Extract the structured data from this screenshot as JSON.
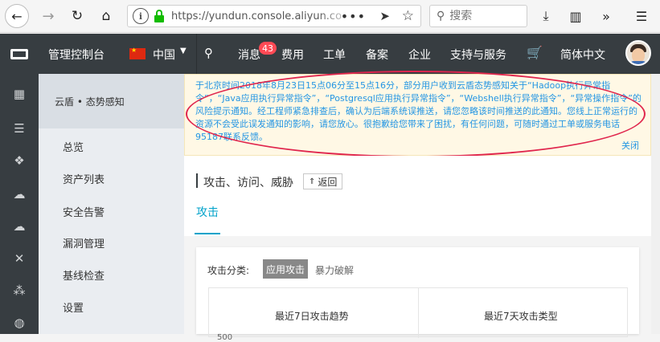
{
  "browser": {
    "url": "https://yundun.console.aliyun.co",
    "search_placeholder": "搜索"
  },
  "topnav": {
    "console_label": "管理控制台",
    "region": "中国",
    "messages_label": "消息",
    "messages_count": "43",
    "items": [
      "费用",
      "工单",
      "备案",
      "企业",
      "支持与服务"
    ],
    "language": "简体中文"
  },
  "sidebar": {
    "product_title": "云盾 • 态势感知",
    "items": [
      "总览",
      "资产列表",
      "安全告警",
      "漏洞管理",
      "基线检查",
      "设置"
    ]
  },
  "notice": {
    "text": "于北京时间2018年8月23日15点06分至15点16分，部分用户收到云盾态势感知关于“Hadoop执行异常指令”，“Java应用执行异常指令”，“Postgresql应用执行异常指令”，“Webshell执行异常指令”，“异常操作指令”的风险提示通知。经工程师紧急排查后，确认为后端系统误推送，请您忽略该时间推送的此通知。您线上正常运行的资源不会受此误发通知的影响，请您放心。很抱歉给您带来了困扰，有任何问题，可随时通过工单或服务电话95187联系反馈。",
    "close_label": "关闭"
  },
  "page": {
    "title": "攻击、访问、威胁",
    "back_label": "返回",
    "tab_label": "攻击"
  },
  "card": {
    "filter_label": "攻击分类:",
    "filter_active": "应用攻击",
    "filter_other": "暴力破解",
    "chart_left_title": "最近7日攻击趋势",
    "chart_right_title": "最近7天攻击类型",
    "y_tick_top": "500"
  }
}
